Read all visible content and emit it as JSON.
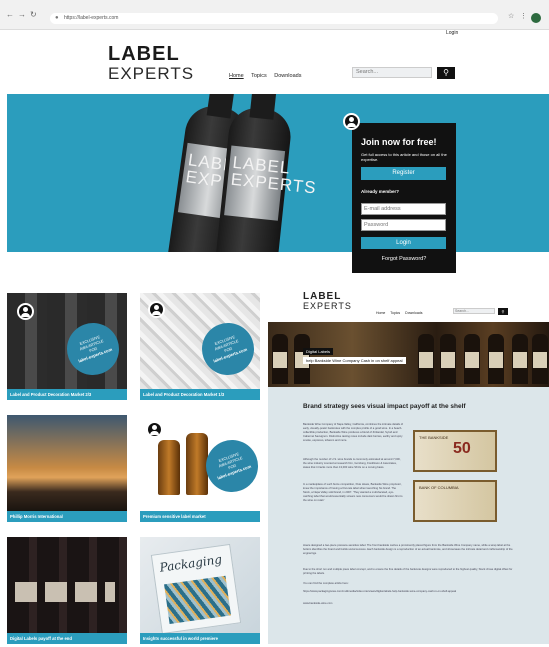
{
  "browser": {
    "url": "https://label-experts.com"
  },
  "header": {
    "login_link": "Login",
    "logo_line1": "LABEL",
    "logo_line2": "EXPERTS",
    "nav": [
      "Home",
      "Topics",
      "Downloads"
    ],
    "search_placeholder": "Search..."
  },
  "hero": {
    "bottle_label_line1": "LABEL",
    "bottle_label_line2": "EXPERTS",
    "join": {
      "title": "Join now for free!",
      "subtitle": "Get full access to this article and those on all the expertise.",
      "register_label": "Register",
      "already_member": "Already member?",
      "email_placeholder": "E-mail address",
      "password_placeholder": "Password",
      "login_label": "Login",
      "forgot_label": "Forgot Password?"
    }
  },
  "cards": [
    {
      "caption": "Label and Product Decoration Market 2/3"
    },
    {
      "caption": "Label and Product Decoration Market 1/3"
    },
    {
      "caption": "Phillip Morris International"
    },
    {
      "caption": "Premium sensitive label market"
    },
    {
      "caption": "Digital Labels payoff at the end"
    },
    {
      "caption": "Insights successful in world premiere"
    }
  ],
  "badge": {
    "line1": "EXCLUSIVE",
    "line2": "AWA ARTICLE",
    "line3": "FOR",
    "line4": "label-experts.com"
  },
  "magazine_title": "Packaging",
  "article": {
    "logo_line1": "LABEL",
    "logo_line2": "EXPERTS",
    "nav": [
      "Home",
      "Topics",
      "Downloads"
    ],
    "search_placeholder": "Search...",
    "tag1": "Digital Labels",
    "tag2": "help Bankside Wine Company Cash in on shelf appeal",
    "headline": "Brand strategy sees visual impact payoff at the shelf",
    "body": [
      "Bankside Wine Company of Napa Valley, California, combines the intimate details of early, visually-poetic banknotes with the complex profile of a good wine. In a beach-collectible production, Bankside Wine produces a blend of Zinfandel, Syrah and Cabernet Sauvignon. Distinctive tasting notes include dark berries, earthy and spicy smoke, espresso, tobacco and more.",
      "Although the number of U.S. wine brands is commonly estimated at around 7,000, the wine industry counted at research firm, Gomberg, Fredrikson & Associates, states that it tracks more than 13,000 wine SKUs on a moving basis.",
      "In a marketplace of such fierce competition, Pete Hoare, Bankside Wine proprietor, knew the importance of having a first-rate label when launching his brand. The Stock, a Napa Valley sold brand, in 2007. 'They wanted a multi-faceted, eye-catching label that would essentially scream new consumers would be drawn first to the wine on retail.'",
      "Hoare designed a two-piece pressure-sensitive label. The front bankside carries a prominently placed figure from the Bankside Wine Company name, while a wrap label at the bottom identifies the brand and builds social success. Each bankside design is a reproduction of an actual banknote, and showcases the intricate detail and craftsmanship of the engravings.",
      "Due to the short run and multiple piece label concept, and to ensure the fine details of the banknote designs were reproduced to the highest quality, Stock chose digital offset for printing the labels.",
      "You can find the complete article here:"
    ],
    "link1": "https://www.packagingnews.com/multimedia/video-interviews/digital-labels-help-bankside-wine-company-cash-in-on-shelf-appeal",
    "link2": "www.bankside-wine.com",
    "bill1_text": "THE BANKSIDE",
    "bill1_number": "50",
    "bill2_text": "BANK OF COLUMBIA"
  },
  "colors": {
    "accent": "#2b9dbd",
    "dark": "#111111"
  }
}
